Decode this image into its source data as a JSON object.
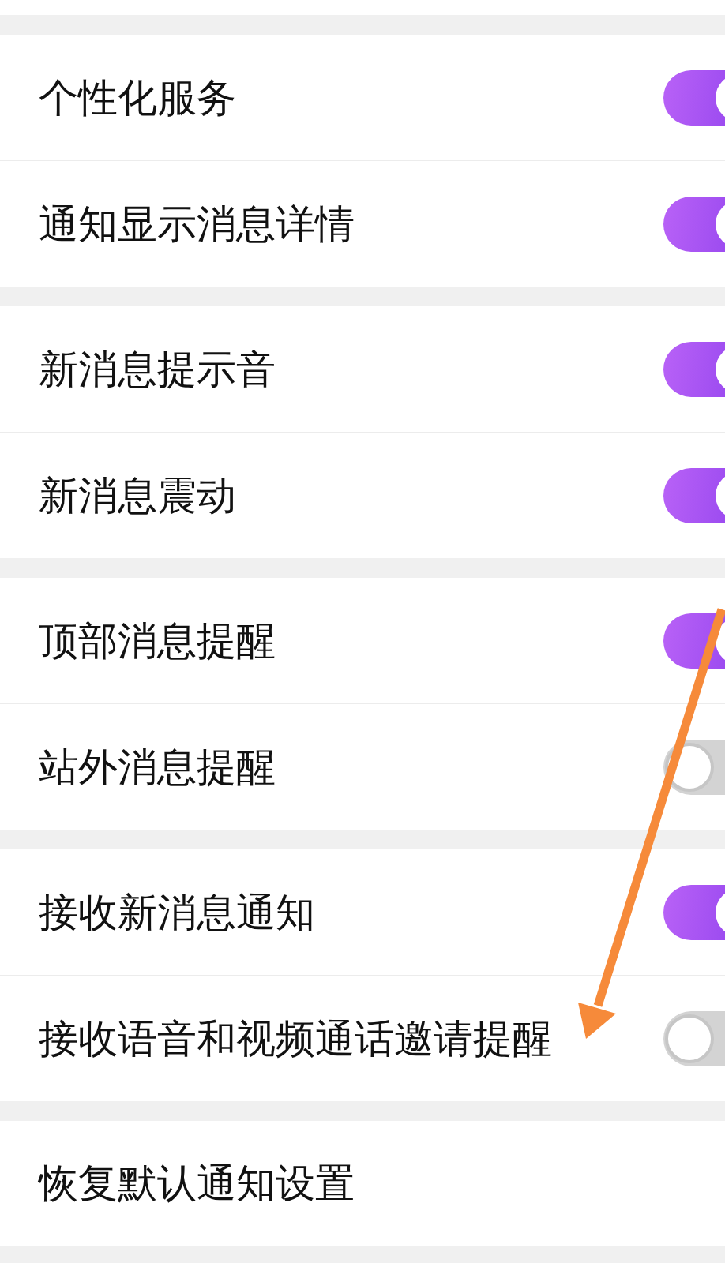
{
  "groups": [
    {
      "items": [
        {
          "kind": "toggle",
          "label": "个性化服务",
          "on": true
        },
        {
          "kind": "toggle",
          "label": "通知显示消息详情",
          "on": true
        }
      ]
    },
    {
      "items": [
        {
          "kind": "toggle",
          "label": "新消息提示音",
          "on": true
        },
        {
          "kind": "toggle",
          "label": "新消息震动",
          "on": true
        }
      ]
    },
    {
      "items": [
        {
          "kind": "toggle",
          "label": "顶部消息提醒",
          "on": true
        },
        {
          "kind": "toggle",
          "label": "站外消息提醒",
          "on": false
        }
      ]
    },
    {
      "items": [
        {
          "kind": "toggle",
          "label": "接收新消息通知",
          "on": true
        },
        {
          "kind": "toggle",
          "label": "接收语音和视频通话邀请提醒",
          "on": false
        }
      ]
    },
    {
      "items": [
        {
          "kind": "action",
          "label": "恢复默认通知设置"
        }
      ]
    }
  ],
  "annotations": [
    {
      "kind": "arrow"
    }
  ]
}
